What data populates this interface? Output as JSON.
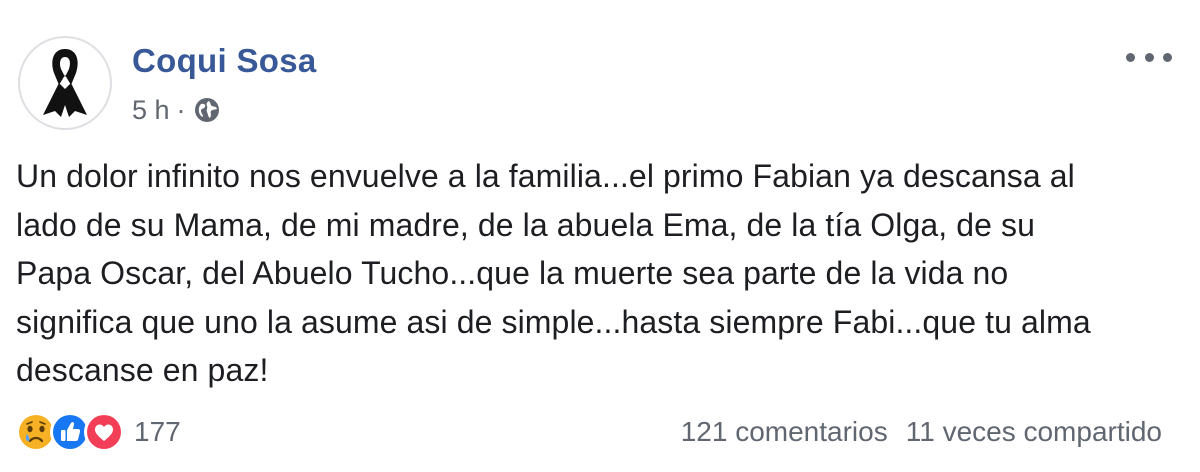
{
  "post": {
    "author": "Coqui Sosa",
    "time": "5 h",
    "separator": "·",
    "audience_icon": "globe-icon",
    "avatar_icon": "mourning-ribbon-icon",
    "more_icon": "more-options-icon",
    "text": "Un dolor infinito nos envuelve a la familia...el primo Fabian ya descansa al\nlado de su Mama, de mi madre, de la abuela Ema, de la tía Olga, de su\nPapa Oscar, del Abuelo Tucho...que la muerte sea parte de la vida no\nsignifica que uno la asume asi de simple...hasta siempre Fabi...que tu alma\ndescanse en paz!"
  },
  "footer": {
    "reactions": [
      "sad",
      "like",
      "love"
    ],
    "reaction_count": "177",
    "comments": "121 comentarios",
    "shares": "11 veces compartido"
  },
  "colors": {
    "author": "#385898",
    "secondary_text": "#606770",
    "like_blue": "#1877f2",
    "love_red": "#f33e58",
    "sad_yellow": "#f7b125"
  }
}
